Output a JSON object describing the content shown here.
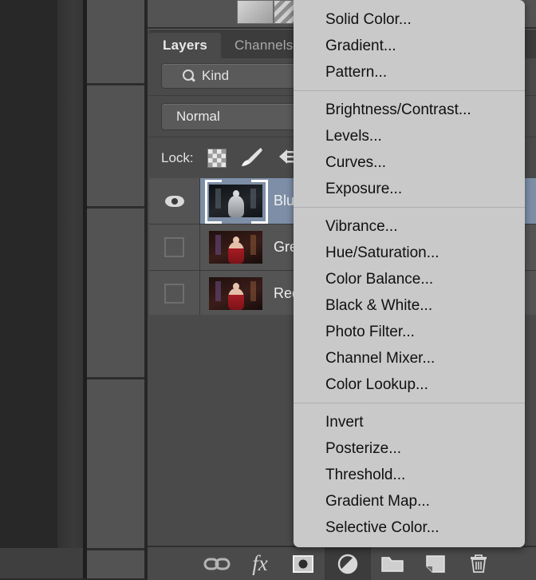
{
  "app": {
    "panel": {
      "tabs": [
        {
          "label": "Layers",
          "active": true
        },
        {
          "label": "Channels",
          "active": false
        }
      ],
      "filter": {
        "icon": "search-icon",
        "value": "Kind",
        "stepper": "▴▾"
      },
      "blend_mode": "Normal",
      "lock": {
        "label": "Lock:",
        "icons": [
          "transparency-checker-icon",
          "brush-icon",
          "move-arrows-icon"
        ]
      },
      "layers": [
        {
          "name": "Blue",
          "visible": true,
          "selected": true,
          "thumb": "portrait-grayscale"
        },
        {
          "name": "Green",
          "visible": false,
          "selected": false,
          "thumb": "portrait-color"
        },
        {
          "name": "Red",
          "visible": false,
          "selected": false,
          "thumb": "portrait-color"
        }
      ],
      "bottom_bar": [
        {
          "icon": "link-icon",
          "active": false
        },
        {
          "icon": "fx-icon",
          "active": false
        },
        {
          "icon": "layer-mask-icon",
          "active": false
        },
        {
          "icon": "adjustment-layer-icon",
          "active": true
        },
        {
          "icon": "new-group-icon",
          "active": false
        },
        {
          "icon": "new-layer-icon",
          "active": false
        },
        {
          "icon": "delete-layer-icon",
          "active": false
        }
      ]
    },
    "context_menu": {
      "name": "adjustment-layer-menu",
      "sections": [
        {
          "items": [
            "Solid Color...",
            "Gradient...",
            "Pattern..."
          ]
        },
        {
          "items": [
            "Brightness/Contrast...",
            "Levels...",
            "Curves...",
            "Exposure..."
          ]
        },
        {
          "items": [
            "Vibrance...",
            "Hue/Saturation...",
            "Color Balance...",
            "Black & White...",
            "Photo Filter...",
            "Channel Mixer...",
            "Color Lookup..."
          ]
        },
        {
          "items": [
            "Invert",
            "Posterize...",
            "Threshold...",
            "Gradient Map...",
            "Selective Color..."
          ]
        }
      ]
    },
    "colors": {
      "menu_bg": "#c9c9c9",
      "panel_bg": "#4a4a4a",
      "selection_blue": "#7d8ea6",
      "canvas_bg": "#282828"
    }
  }
}
